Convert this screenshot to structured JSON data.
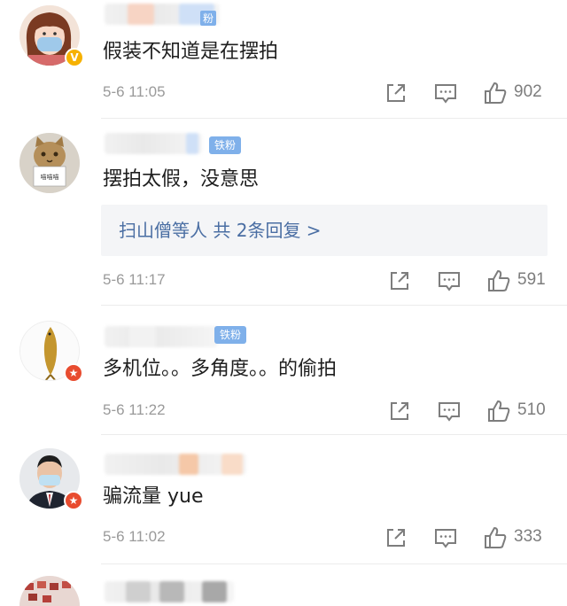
{
  "comments": [
    {
      "text": "假装不知道是在摆拍",
      "time": "5-6 11:05",
      "likes": "902",
      "badge": "",
      "verify": "V"
    },
    {
      "text": "摆拍太假，没意思",
      "time": "5-6 11:17",
      "likes": "591",
      "badge": "铁粉",
      "reply": "扫山僧等人  共 2条回复 >"
    },
    {
      "text": "多机位。。多角度。。的偷拍",
      "time": "5-6 11:22",
      "likes": "510",
      "badge": "铁粉",
      "verify": "★"
    },
    {
      "text": "骗流量 yue",
      "time": "5-6 11:02",
      "likes": "333",
      "badge": "",
      "verify": "★"
    }
  ],
  "cat_sign_text": "喵喵喵",
  "partial_badge_text": "粉",
  "colors": {
    "link": "#4a6ea3",
    "fan_badge": "#7fb0ea",
    "meta_gray": "#9a9a9a"
  },
  "icons": [
    "share-icon",
    "comment-icon",
    "like-icon"
  ]
}
